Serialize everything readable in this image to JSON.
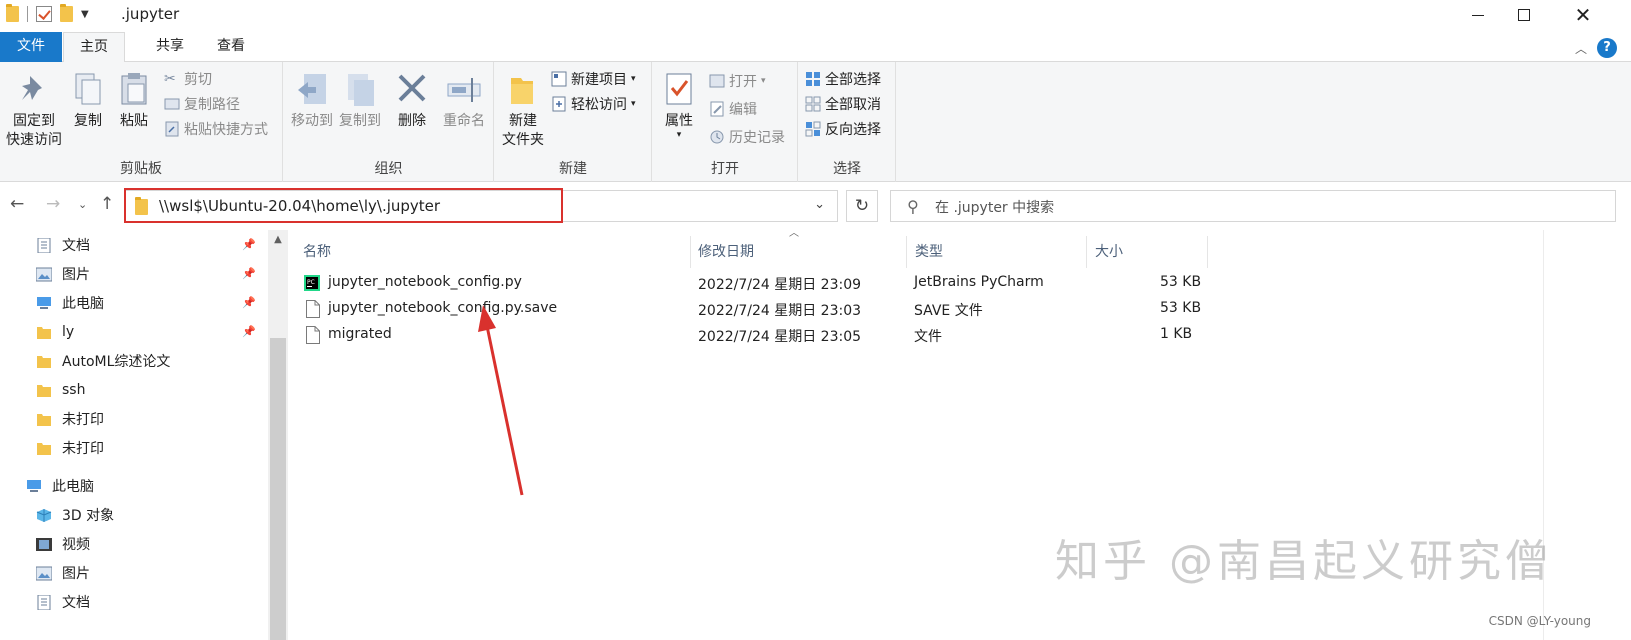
{
  "window": {
    "title": ".jupyter",
    "controls": {
      "minimize": "—",
      "maximize": "☐",
      "close": "✕"
    }
  },
  "ribbon_tabs": [
    "文件",
    "主页",
    "共享",
    "查看"
  ],
  "ribbon": {
    "clipboard": {
      "label": "剪贴板",
      "pin": "固定到\n快速访问",
      "pin_l1": "固定到",
      "pin_l2": "快速访问",
      "copy": "复制",
      "paste": "粘贴",
      "cut": "剪切",
      "copy_path": "复制路径",
      "paste_shortcut": "粘贴快捷方式"
    },
    "organize": {
      "label": "组织",
      "move_to": "移动到",
      "copy_to": "复制到",
      "delete": "删除",
      "rename": "重命名"
    },
    "new": {
      "label": "新建",
      "new_folder_l1": "新建",
      "new_folder_l2": "文件夹",
      "new_item": "新建项目",
      "easy_access": "轻松访问"
    },
    "open": {
      "label": "打开",
      "properties": "属性",
      "open": "打开",
      "edit": "编辑",
      "history": "历史记录"
    },
    "select": {
      "label": "选择",
      "select_all": "全部选择",
      "select_none": "全部取消",
      "invert": "反向选择"
    }
  },
  "address": {
    "path": "\\\\wsl$\\Ubuntu-20.04\\home\\ly\\.jupyter",
    "search_placeholder": "在 .jupyter 中搜索"
  },
  "nav_pane": {
    "quick_access": [
      {
        "label": "文档",
        "icon": "documents-icon",
        "pinned": true
      },
      {
        "label": "图片",
        "icon": "pictures-icon",
        "pinned": true
      },
      {
        "label": "此电脑",
        "icon": "computer-icon",
        "pinned": true
      },
      {
        "label": "ly",
        "icon": "folder-icon",
        "pinned": true
      },
      {
        "label": "AutoML综述论文",
        "icon": "folder-icon",
        "pinned": false
      },
      {
        "label": "ssh",
        "icon": "folder-icon",
        "pinned": false
      },
      {
        "label": "未打印",
        "icon": "folder-icon",
        "pinned": false
      },
      {
        "label": "未打印",
        "icon": "folder-icon",
        "pinned": false
      }
    ],
    "this_pc": {
      "label": "此电脑"
    },
    "this_pc_items": [
      {
        "label": "3D 对象",
        "icon": "3d-objects-icon"
      },
      {
        "label": "视频",
        "icon": "videos-icon"
      },
      {
        "label": "图片",
        "icon": "pictures-icon"
      },
      {
        "label": "文档",
        "icon": "documents-icon"
      }
    ]
  },
  "columns": [
    "名称",
    "修改日期",
    "类型",
    "大小"
  ],
  "files": [
    {
      "name": "jupyter_notebook_config.py",
      "date": "2022/7/24 星期日 23:09",
      "type": "JetBrains PyCharm",
      "size": "53 KB",
      "icon": "pycharm-file-icon"
    },
    {
      "name": "jupyter_notebook_config.py.save",
      "date": "2022/7/24 星期日 23:03",
      "type": "SAVE 文件",
      "size": "53 KB",
      "icon": "blank-file-icon"
    },
    {
      "name": "migrated",
      "date": "2022/7/24 星期日 23:05",
      "type": "文件",
      "size": "1 KB",
      "icon": "blank-file-icon"
    }
  ],
  "watermark": {
    "main": "知乎 @南昌起义研究僧",
    "csdn": "CSDN @LY-young"
  },
  "colors": {
    "file_tab": "#1979ca",
    "annotation_red": "#d9312d",
    "folder": "#f3c34b"
  }
}
